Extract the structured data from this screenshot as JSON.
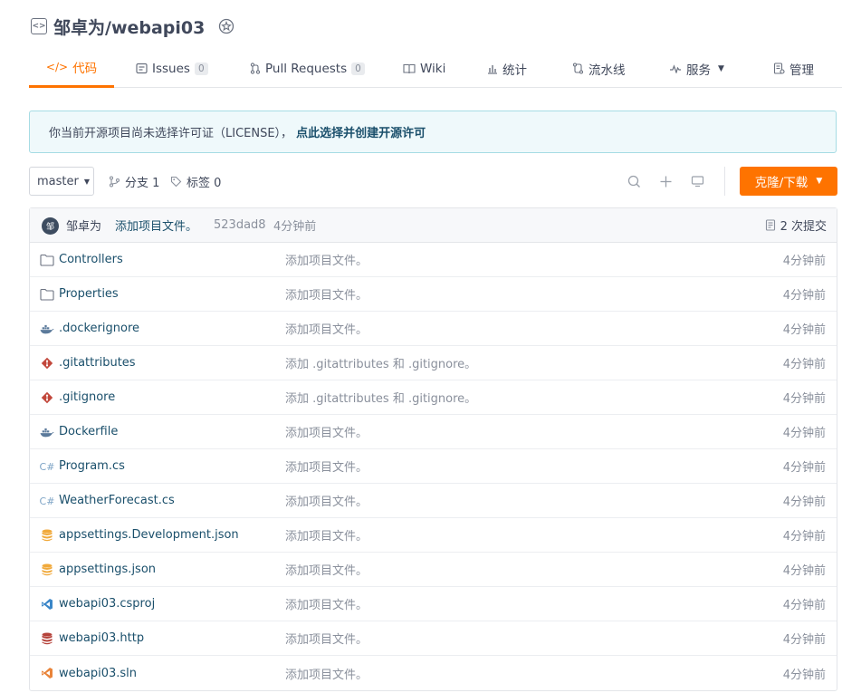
{
  "repo": {
    "title": "邹卓为/webapi03"
  },
  "tabs": [
    {
      "label": "代码",
      "icon": "code-icon",
      "active": true
    },
    {
      "label": "Issues",
      "icon": "issues-icon",
      "count": "0"
    },
    {
      "label": "Pull Requests",
      "icon": "pull-request-icon",
      "count": "0"
    },
    {
      "label": "Wiki",
      "icon": "wiki-icon"
    },
    {
      "label": "统计",
      "icon": "stats-icon"
    },
    {
      "label": "流水线",
      "icon": "pipeline-icon"
    },
    {
      "label": "服务",
      "icon": "service-icon"
    },
    {
      "label": "管理",
      "icon": "manage-icon"
    }
  ],
  "notice": {
    "text": "你当前开源项目尚未选择许可证（LICENSE），",
    "link": "点此选择并创建开源许可"
  },
  "toolbar": {
    "branch": "master",
    "branches_label": "分支 1",
    "tags_label": "标签 0",
    "clone_label": "克隆/下载"
  },
  "latest_commit": {
    "avatar_text": "邹",
    "author": "邹卓为",
    "message": "添加项目文件。",
    "sha": "523dad8",
    "time": "4分钟前",
    "commit_count": "2 次提交"
  },
  "files": [
    {
      "name": "Controllers",
      "type": "folder",
      "message": "添加项目文件。",
      "time": "4分钟前"
    },
    {
      "name": "Properties",
      "type": "folder",
      "message": "添加项目文件。",
      "time": "4分钟前"
    },
    {
      "name": ".dockerignore",
      "type": "docker",
      "message": "添加项目文件。",
      "time": "4分钟前"
    },
    {
      "name": ".gitattributes",
      "type": "git",
      "message": "添加 .gitattributes 和 .gitignore。",
      "time": "4分钟前"
    },
    {
      "name": ".gitignore",
      "type": "git",
      "message": "添加 .gitattributes 和 .gitignore。",
      "time": "4分钟前"
    },
    {
      "name": "Dockerfile",
      "type": "docker",
      "message": "添加项目文件。",
      "time": "4分钟前"
    },
    {
      "name": "Program.cs",
      "type": "csharp",
      "message": "添加项目文件。",
      "time": "4分钟前"
    },
    {
      "name": "WeatherForecast.cs",
      "type": "csharp",
      "message": "添加项目文件。",
      "time": "4分钟前"
    },
    {
      "name": "appsettings.Development.json",
      "type": "json",
      "message": "添加项目文件。",
      "time": "4分钟前"
    },
    {
      "name": "appsettings.json",
      "type": "json",
      "message": "添加项目文件。",
      "time": "4分钟前"
    },
    {
      "name": "webapi03.csproj",
      "type": "vs-blue",
      "message": "添加项目文件。",
      "time": "4分钟前"
    },
    {
      "name": "webapi03.http",
      "type": "db",
      "message": "添加项目文件。",
      "time": "4分钟前"
    },
    {
      "name": "webapi03.sln",
      "type": "vs-orange",
      "message": "添加项目文件。",
      "time": "4分钟前"
    }
  ],
  "colors": {
    "accent": "#fe7300",
    "link": "#1a4f6b",
    "muted": "#8a909c"
  }
}
